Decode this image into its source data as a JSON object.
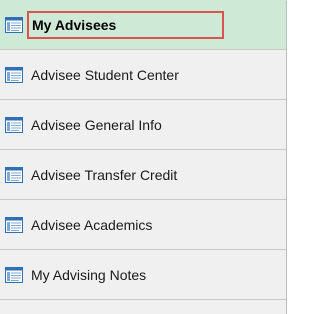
{
  "nav": {
    "items": [
      {
        "label": "My Advisees",
        "selected": true,
        "icon": "page-icon"
      },
      {
        "label": "Advisee Student Center",
        "selected": false,
        "icon": "page-icon"
      },
      {
        "label": "Advisee General Info",
        "selected": false,
        "icon": "page-icon"
      },
      {
        "label": "Advisee Transfer Credit",
        "selected": false,
        "icon": "page-icon"
      },
      {
        "label": "Advisee Academics",
        "selected": false,
        "icon": "page-icon"
      },
      {
        "label": "My Advising Notes",
        "selected": false,
        "icon": "page-icon"
      }
    ]
  },
  "colors": {
    "selected_bg": "#cfe9d7",
    "focus_outline": "#d9534f",
    "icon_blue": "#2f6fb5"
  }
}
